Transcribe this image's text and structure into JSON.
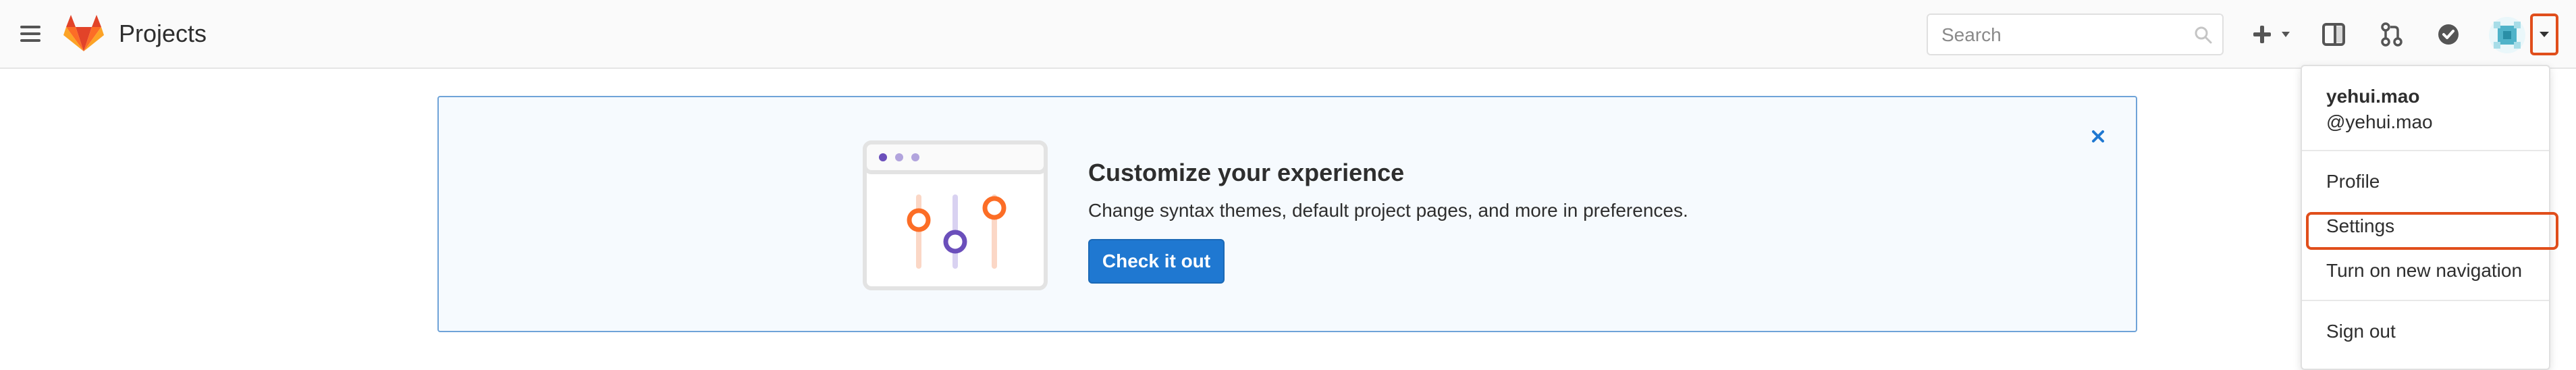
{
  "header": {
    "title": "Projects",
    "search_placeholder": "Search",
    "icons": {
      "menu": "hamburger-menu-icon",
      "logo": "gitlab-tanuki-logo",
      "search": "search-icon",
      "new": "plus-icon",
      "panel": "sidebar-panel-icon",
      "merge_requests": "merge-request-icon",
      "todos": "todo-check-icon",
      "avatar": "user-avatar",
      "caret": "chevron-down-icon"
    }
  },
  "callout": {
    "title": "Customize your experience",
    "description": "Change syntax themes, default project pages, and more in preferences.",
    "button_label": "Check it out",
    "close_icon": "close-icon"
  },
  "dropdown": {
    "username": "yehui.mao",
    "handle": "@yehui.mao",
    "items": [
      {
        "label": "Profile"
      },
      {
        "label": "Settings"
      },
      {
        "label": "Turn on new navigation"
      },
      {
        "label": "Sign out"
      }
    ]
  },
  "colors": {
    "highlight": "#e04e1b",
    "primary_button": "#1f78d1",
    "callout_border": "#6fa3d8"
  }
}
